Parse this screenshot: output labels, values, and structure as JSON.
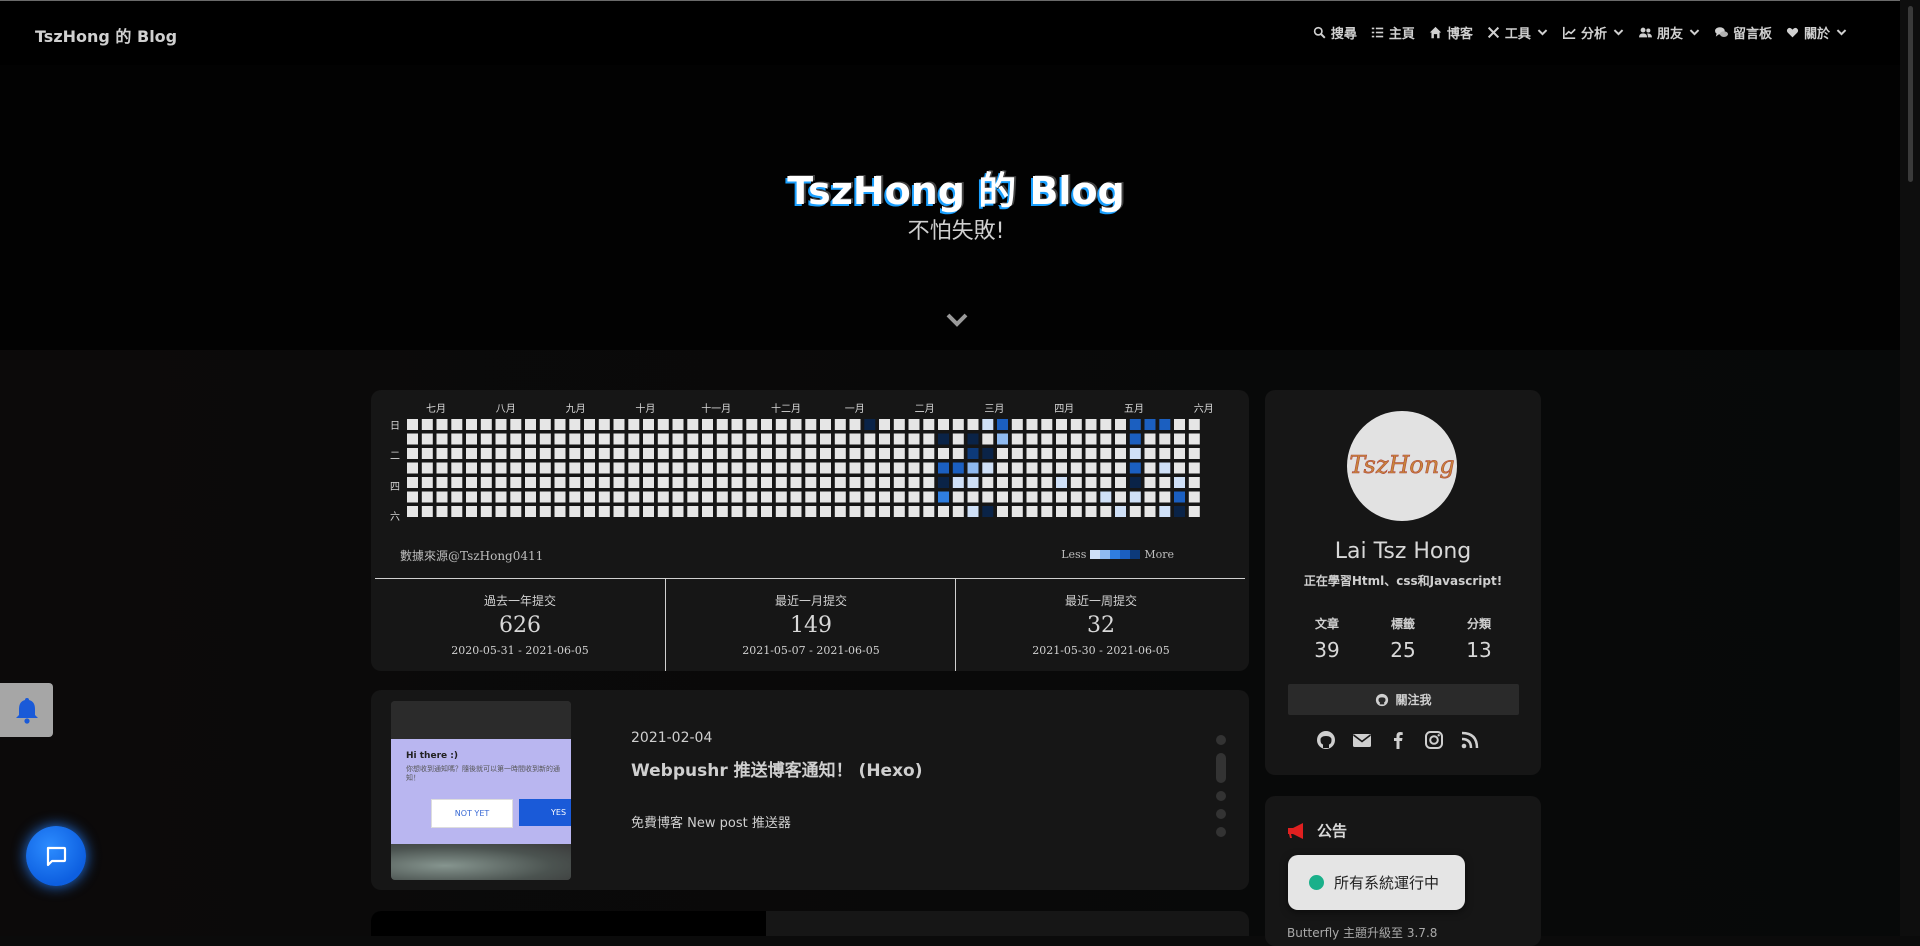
{
  "nav": {
    "site_name": "TszHong 的 Blog",
    "items": [
      {
        "label": "搜尋",
        "icon": "search-icon"
      },
      {
        "label": "主頁",
        "icon": "list-icon"
      },
      {
        "label": "博客",
        "icon": "home-icon"
      },
      {
        "label": "工具",
        "icon": "tools-icon",
        "has_dropdown": true
      },
      {
        "label": "分析",
        "icon": "chart-icon",
        "has_dropdown": true
      },
      {
        "label": "朋友",
        "icon": "users-icon",
        "has_dropdown": true
      },
      {
        "label": "留言板",
        "icon": "comments-icon"
      },
      {
        "label": "關於",
        "icon": "heart-icon",
        "has_dropdown": true
      }
    ]
  },
  "hero": {
    "title": "TszHong 的 Blog",
    "subtitle": "不怕失敗!"
  },
  "contributions": {
    "months": [
      "七月",
      "八月",
      "九月",
      "十月",
      "十一月",
      "十二月",
      "一月",
      "二月",
      "三月",
      "四月",
      "五月",
      "六月"
    ],
    "day_labels": [
      "日",
      "二",
      "四",
      "六"
    ],
    "colors": [
      "#e6e6e6",
      "#cfe0f7",
      "#8fbaf0",
      "#2f7ee0",
      "#1b5fc0",
      "#0d3a7a",
      "#0a2347"
    ],
    "weeks": 54,
    "active_cells": [
      {
        "week": 31,
        "day": 0,
        "level": 6
      },
      {
        "week": 36,
        "day": 1,
        "level": 6
      },
      {
        "week": 38,
        "day": 1,
        "level": 6
      },
      {
        "week": 38,
        "day": 2,
        "level": 5
      },
      {
        "week": 37,
        "day": 3,
        "level": 4
      },
      {
        "week": 39,
        "day": 2,
        "level": 6
      },
      {
        "week": 40,
        "day": 0,
        "level": 4
      },
      {
        "week": 40,
        "day": 1,
        "level": 2
      },
      {
        "week": 39,
        "day": 0,
        "level": 1
      },
      {
        "week": 36,
        "day": 3,
        "level": 4
      },
      {
        "week": 36,
        "day": 4,
        "level": 6
      },
      {
        "week": 36,
        "day": 5,
        "level": 3
      },
      {
        "week": 37,
        "day": 4,
        "level": 1
      },
      {
        "week": 38,
        "day": 3,
        "level": 2
      },
      {
        "week": 38,
        "day": 4,
        "level": 1
      },
      {
        "week": 39,
        "day": 3,
        "level": 1
      },
      {
        "week": 39,
        "day": 6,
        "level": 6
      },
      {
        "week": 38,
        "day": 6,
        "level": 1
      },
      {
        "week": 44,
        "day": 4,
        "level": 1
      },
      {
        "week": 47,
        "day": 5,
        "level": 1
      },
      {
        "week": 48,
        "day": 6,
        "level": 1
      },
      {
        "week": 49,
        "day": 0,
        "level": 4
      },
      {
        "week": 49,
        "day": 1,
        "level": 4
      },
      {
        "week": 49,
        "day": 2,
        "level": 1
      },
      {
        "week": 49,
        "day": 3,
        "level": 4
      },
      {
        "week": 49,
        "day": 4,
        "level": 6
      },
      {
        "week": 49,
        "day": 5,
        "level": 1
      },
      {
        "week": 50,
        "day": 0,
        "level": 4
      },
      {
        "week": 51,
        "day": 0,
        "level": 4
      },
      {
        "week": 51,
        "day": 3,
        "level": 1
      },
      {
        "week": 51,
        "day": 6,
        "level": 1
      },
      {
        "week": 52,
        "day": 4,
        "level": 1
      },
      {
        "week": 52,
        "day": 5,
        "level": 4
      },
      {
        "week": 52,
        "day": 6,
        "level": 6
      }
    ],
    "source_prefix": "數據來源",
    "source_user": "@TszHong0411",
    "legend_less": "Less",
    "legend_more": "More",
    "stats": [
      {
        "label": "過去一年提交",
        "value": "626",
        "range": "2020-05-31 - 2021-06-05"
      },
      {
        "label": "最近一月提交",
        "value": "149",
        "range": "2021-05-07 - 2021-06-05"
      },
      {
        "label": "最近一周提交",
        "value": "32",
        "range": "2021-05-30 - 2021-06-05"
      }
    ]
  },
  "post": {
    "date": "2021-02-04",
    "title": "Webpushr 推送博客通知！ (Hexo)",
    "description": "免費博客 New post 推送器",
    "thumb": {
      "greeting": "Hi there :)",
      "message": "你想收到通知嗎？隨後就可以第一時間收到新的通知！",
      "no_label": "NOT YET",
      "yes_label": "YES"
    }
  },
  "profile": {
    "avatar_text": "TszHong",
    "name": "Lai Tsz Hong",
    "bio": "正在學習Html、css和Javascript!",
    "stats": [
      {
        "label": "文章",
        "value": "39"
      },
      {
        "label": "標籤",
        "value": "25"
      },
      {
        "label": "分類",
        "value": "13"
      }
    ],
    "follow_label": "關注我",
    "social_icons": [
      "github-icon",
      "email-icon",
      "facebook-icon",
      "instagram-icon",
      "rss-icon"
    ]
  },
  "announcement": {
    "title": "公告",
    "peek_text": "Butterfly 主題升級至 3.7.8"
  },
  "status_widget": {
    "label": "所有系統運行中",
    "dot_color": "#1ab08a"
  }
}
